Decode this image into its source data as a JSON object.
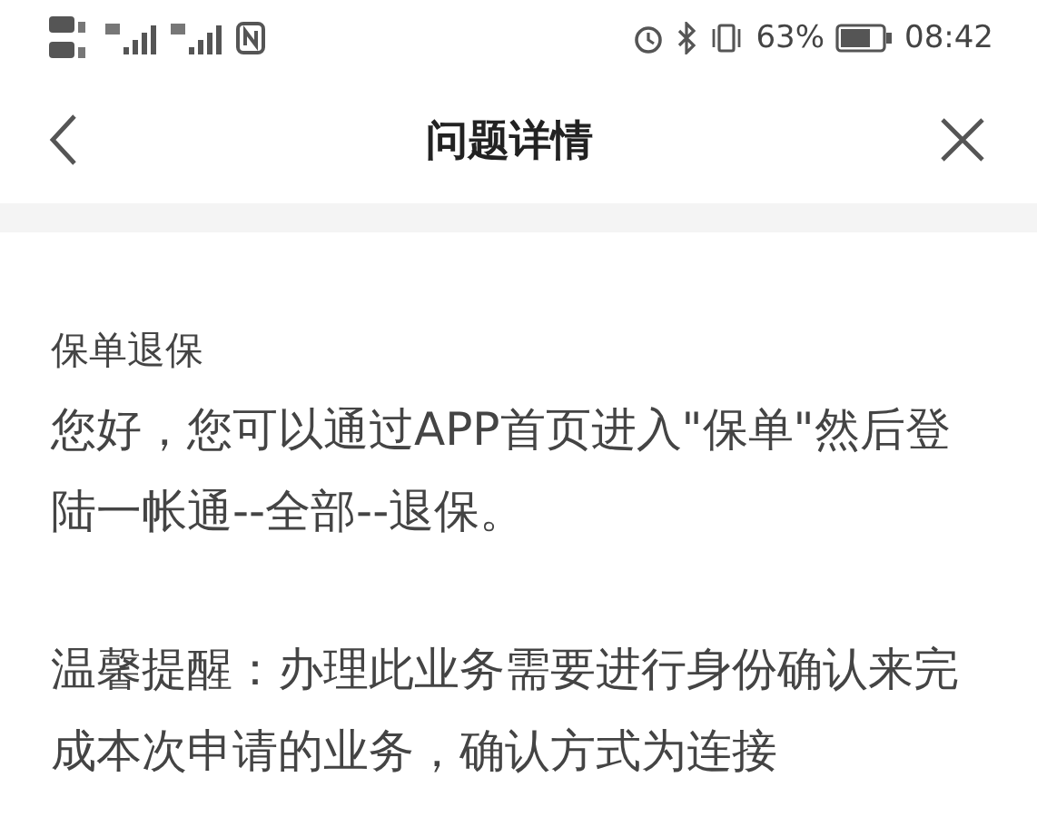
{
  "status_bar": {
    "battery_percent": "63%",
    "time": "08:42"
  },
  "nav_bar": {
    "title": "问题详情"
  },
  "article": {
    "title": "保单退保",
    "paragraphs": [
      "您好，您可以通过APP首页进入\"保单\"然后登陆一帐通--全部--退保。",
      "温馨提醒：办理此业务需要进行身份确认来完成本次申请的业务，确认方式为连接"
    ]
  }
}
